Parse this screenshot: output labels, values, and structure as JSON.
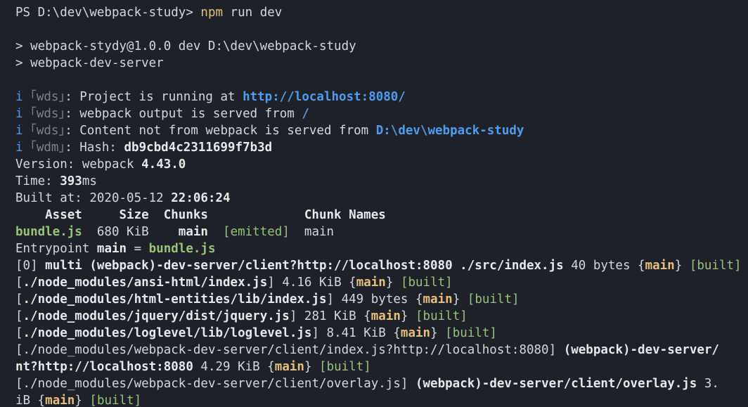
{
  "terminal": {
    "prompt": {
      "ps": "PS D:\\dev\\webpack-study> ",
      "cmd": "npm",
      "args": " run dev"
    },
    "script_lines": [
      "> webpack-stydy@1.0.0 dev D:\\dev\\webpack-study",
      "> webpack-dev-server"
    ],
    "wds": {
      "icon": "i",
      "bracket_wds": "｢wds｣",
      "bracket_wdm": "｢wdm｣",
      "line1_text": ": Project is running at ",
      "line1_url": "http://localhost:8080/",
      "line2_text": ": webpack output is served from ",
      "line2_path": "/",
      "line3_text": ": Content not from webpack is served from ",
      "line3_path": "D:\\dev\\webpack-study",
      "hash_label": ": Hash: ",
      "hash_value": "db9cbd4c2311699f7b3d"
    },
    "build": {
      "version_label": "Version: webpack ",
      "version_value": "4.43.0",
      "time_label": "Time: ",
      "time_value": "393",
      "time_unit": "ms",
      "built_label": "Built at: 2020-05-12 ",
      "built_time": "22:06:24"
    },
    "asset_table": {
      "header": "    Asset     Size  Chunks             Chunk Names",
      "row_asset": "bundle.js",
      "row_size": "  680 KiB    ",
      "row_chunk": "main",
      "row_status": "[emitted]",
      "row_names": "  main"
    },
    "entrypoint": {
      "label": "Entrypoint ",
      "name": "main",
      "eq": " = ",
      "file": "bundle.js"
    },
    "modules": {
      "m0_id": "[0] ",
      "m0_name": "multi (webpack)-dev-server/client?http://localhost:8080 ./src/index.js",
      "m0_size": " 40 bytes ",
      "m0_status": "[built]",
      "m1_name": "./node_modules/ansi-html/index.js",
      "m1_size": " 4.16 KiB ",
      "m2_name": "./node_modules/html-entities/lib/index.js",
      "m2_size": " 449 bytes ",
      "m3_name": "./node_modules/jquery/dist/jquery.js",
      "m3_size": " 281 KiB ",
      "m4_name": "./node_modules/loglevel/lib/loglevel.js",
      "m4_size": " 8.41 KiB ",
      "m5_name": "./node_modules/webpack-dev-server/client/index.js?http://localhost:8080",
      "m5_label": "(webpack)-dev-server/",
      "m5_cont": "nt?http://localhost:8080",
      "m5_size": " 4.29 KiB ",
      "m6_name": "./node_modules/webpack-dev-server/client/overlay.js",
      "m6_label": "(webpack)-dev-server/client/overlay.js",
      "m6_size_start": " 3.",
      "m6_cont": "iB ",
      "chunk": "main",
      "built": "[built]",
      "lbrace": "{",
      "rbrace": "}",
      "lbracket": "[",
      "rbracket": "]"
    }
  }
}
